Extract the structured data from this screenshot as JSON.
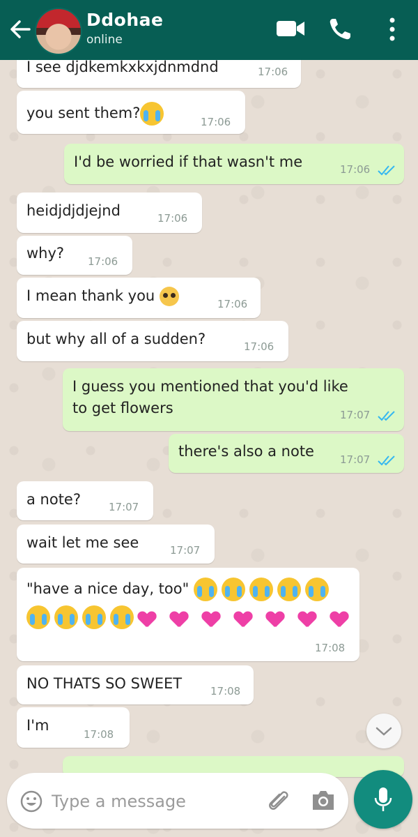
{
  "header": {
    "contact_name": "Ddohae",
    "status": "online",
    "icons": [
      "back-arrow-icon",
      "video-call-icon",
      "voice-call-icon",
      "more-options-icon"
    ],
    "color": "#075e54"
  },
  "messages": [
    {
      "dir": "in",
      "text": "I see djdkemkxkxjdnmdnd",
      "time": "17:06"
    },
    {
      "dir": "in",
      "text": "you sent them?",
      "emoji": "loudly-crying-face",
      "time": "17:06"
    },
    {
      "dir": "out",
      "text": "I'd be worried if that wasn't me",
      "time": "17:06",
      "status": "read"
    },
    {
      "dir": "in",
      "text": "heidjdjdjejnd",
      "time": "17:06"
    },
    {
      "dir": "in",
      "text": "why?",
      "time": "17:06"
    },
    {
      "dir": "in",
      "text": "I mean thank you",
      "emoji": "pleading-face",
      "time": "17:06"
    },
    {
      "dir": "in",
      "text": "but why all of a sudden?",
      "time": "17:06"
    },
    {
      "dir": "out",
      "text_line1": "I guess you mentioned that you'd like",
      "text_line2": "to get flowers",
      "time": "17:07",
      "status": "read"
    },
    {
      "dir": "out",
      "text": "there's also a note",
      "time": "17:07",
      "status": "read"
    },
    {
      "dir": "in",
      "text": "a note?",
      "time": "17:07"
    },
    {
      "dir": "in",
      "text": "wait let me see",
      "time": "17:07"
    },
    {
      "dir": "in",
      "text": "\"have a nice day, too\"",
      "emoji_row1": "5x loudly-crying-face",
      "emoji_row2": "4x loudly-crying-face, 7x two-hearts",
      "time": "17:08"
    },
    {
      "dir": "in",
      "text": "NO THATS SO SWEET",
      "time": "17:08"
    },
    {
      "dir": "in",
      "text": "I'm",
      "time": "17:08"
    }
  ],
  "composer": {
    "placeholder": "Type a message",
    "icons": [
      "emoji-icon",
      "attach-icon",
      "camera-icon",
      "mic-icon"
    ]
  },
  "colors": {
    "incoming": "#ffffff",
    "outgoing": "#dcf8c6",
    "read_ticks": "#34b7f1",
    "fab": "#128c7e"
  }
}
